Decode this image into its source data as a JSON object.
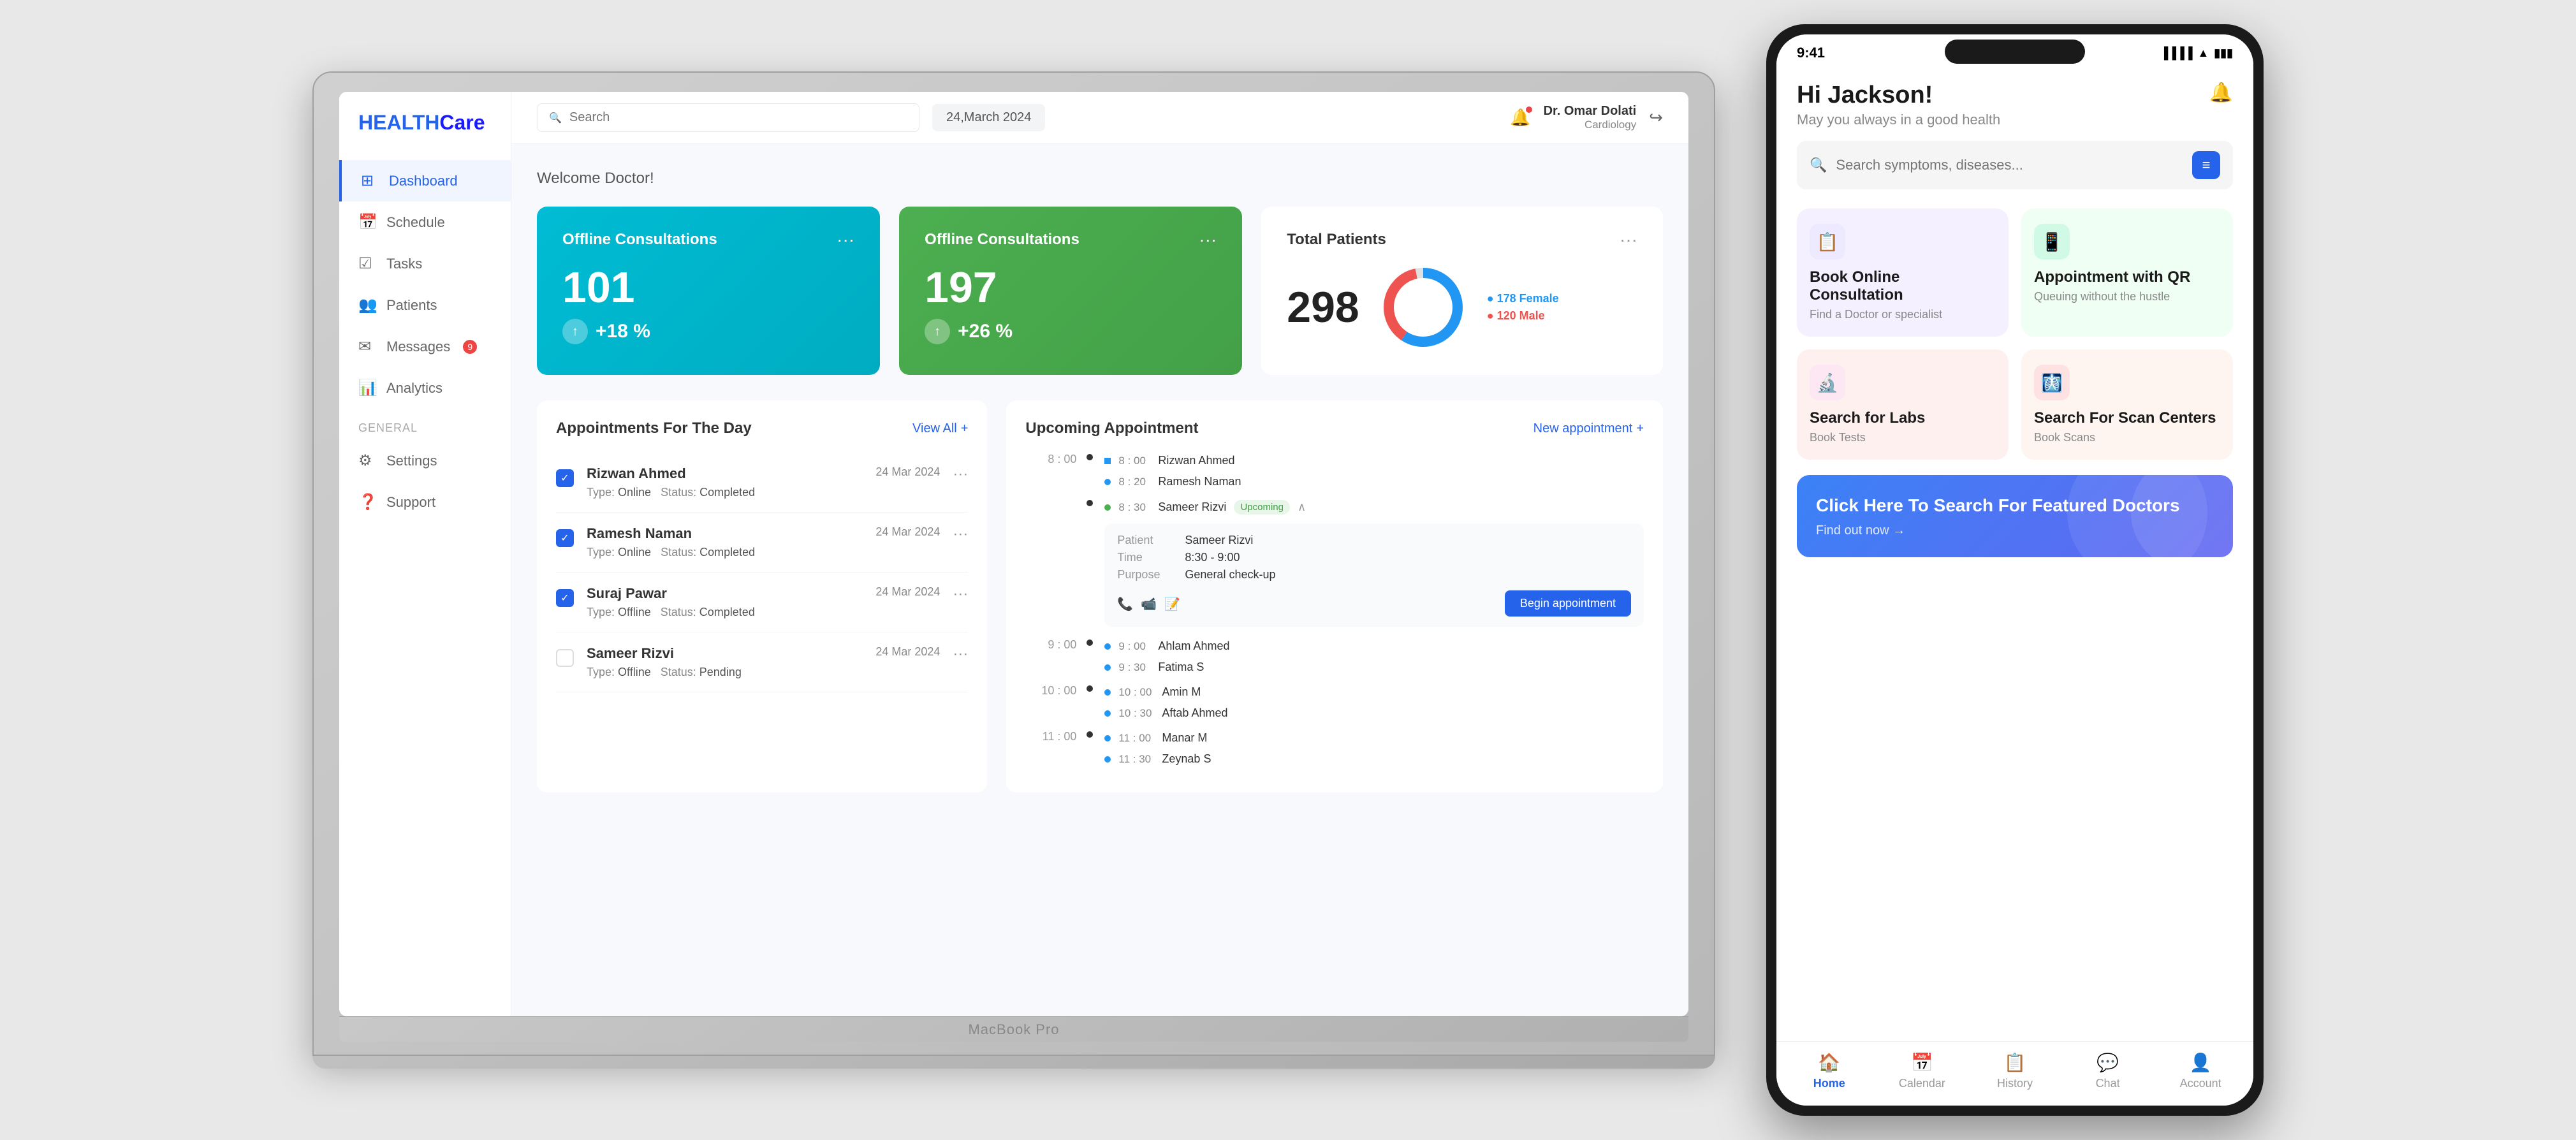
{
  "brand": {
    "name_plain": "HEALTH",
    "name_bold": "Care"
  },
  "sidebar": {
    "items": [
      {
        "id": "dashboard",
        "label": "Dashboard",
        "icon": "⊞",
        "active": true
      },
      {
        "id": "schedule",
        "label": "Schedule",
        "icon": "📅",
        "active": false
      },
      {
        "id": "tasks",
        "label": "Tasks",
        "icon": "☑",
        "active": false
      },
      {
        "id": "patients",
        "label": "Patients",
        "icon": "👥",
        "active": false
      },
      {
        "id": "messages",
        "label": "Messages",
        "icon": "✉",
        "active": false,
        "badge": "9"
      },
      {
        "id": "analytics",
        "label": "Analytics",
        "icon": "📊",
        "active": false
      }
    ],
    "general_label": "GENERAL",
    "general_items": [
      {
        "id": "settings",
        "label": "Settings",
        "icon": "⚙"
      },
      {
        "id": "support",
        "label": "Support",
        "icon": "❓"
      }
    ]
  },
  "topbar": {
    "search_placeholder": "Search",
    "date": "24,March 2024",
    "user_name": "Dr. Omar Dolati",
    "user_dept": "Cardiology"
  },
  "welcome": "Welcome Doctor!",
  "stats": {
    "card1": {
      "title": "Offline Consultations",
      "number": "101",
      "change": "+18 %"
    },
    "card2": {
      "title": "Offline Consultations",
      "number": "197",
      "change": "+26 %"
    },
    "patients": {
      "title": "Total Patients",
      "total": "298",
      "female_count": "178",
      "female_label": "178 Female",
      "male_count": "120",
      "male_label": "120 Male"
    }
  },
  "appointments": {
    "title": "Appointments For The Day",
    "view_all": "View All",
    "items": [
      {
        "name": "Rizwan Ahmed",
        "date": "24 Mar 2024",
        "type": "Online",
        "status": "Completed",
        "checked": true
      },
      {
        "name": "Ramesh Naman",
        "date": "24 Mar 2024",
        "type": "Online",
        "status": "Completed",
        "checked": true
      },
      {
        "name": "Suraj  Pawar",
        "date": "24 Mar 2024",
        "type": "Offline",
        "status": "Completed",
        "checked": true
      },
      {
        "name": "Sameer Rizvi",
        "date": "24 Mar 2024",
        "type": "Offline",
        "status": "Pending",
        "checked": false
      }
    ]
  },
  "upcoming": {
    "title": "Upcoming Appointment",
    "new_btn": "New appointment",
    "timeline": [
      {
        "time": "8 : 00",
        "events": [
          {
            "name": "Rizwan Ahmed",
            "time": "8 : 00",
            "color": "blue"
          },
          {
            "name": "Ramesh Naman",
            "time": "8 : 20",
            "color": "blue"
          }
        ]
      },
      {
        "time": "",
        "events": [
          {
            "name": "Sameer Rizvi",
            "time": "8 : 30",
            "color": "green",
            "badge": "Upcoming",
            "expanded": true
          }
        ]
      },
      {
        "time": "9 : 00",
        "events": [
          {
            "name": "Ahlam Ahmed",
            "time": "9 : 00",
            "color": "blue"
          },
          {
            "name": "Fatima S",
            "time": "9 : 30",
            "color": "blue"
          }
        ]
      },
      {
        "time": "10 : 00",
        "events": [
          {
            "name": "Amin M",
            "time": "10 : 00",
            "color": "blue"
          },
          {
            "name": "Aftab Ahmed",
            "time": "10 : 30",
            "color": "blue"
          }
        ]
      },
      {
        "time": "11 : 00",
        "events": [
          {
            "name": "Manar M",
            "time": "11 : 00",
            "color": "blue"
          },
          {
            "name": "Zeynab S",
            "time": "11 : 30",
            "color": "blue"
          }
        ]
      }
    ],
    "detail": {
      "patient": "Sameer Rizvi",
      "time": "8:30 - 9:00",
      "purpose": "General check-up",
      "begin_btn": "Begin appointment"
    }
  },
  "phone": {
    "status_time": "9:41",
    "greeting": "Hi Jackson!",
    "greeting_sub": "May you always in a good health",
    "search_placeholder": "Search symptoms, diseases...",
    "services": [
      {
        "name": "Book Online Consultation",
        "sub": "Find a Doctor or specialist",
        "color": "light-purple",
        "icon": "📋"
      },
      {
        "name": "Appointment with QR",
        "sub": "Queuing without the hustle",
        "color": "light-green",
        "icon": "📱"
      },
      {
        "name": "Search for Labs",
        "sub": "Book Tests",
        "color": "light-pink",
        "icon": "🔬"
      },
      {
        "name": "Search For Scan Centers",
        "sub": "Book Scans",
        "color": "light-peach",
        "icon": "🩻"
      }
    ],
    "featured": {
      "title": "Click Here To Search For Featured Doctors",
      "link": "Find out now →"
    },
    "nav": [
      {
        "id": "home",
        "label": "Home",
        "icon": "🏠",
        "active": true
      },
      {
        "id": "calendar",
        "label": "Calendar",
        "icon": "📅",
        "active": false
      },
      {
        "id": "history",
        "label": "History",
        "icon": "📋",
        "active": false
      },
      {
        "id": "chat",
        "label": "Chat",
        "icon": "💬",
        "active": false
      },
      {
        "id": "account",
        "label": "Account",
        "icon": "👤",
        "active": false
      }
    ]
  },
  "laptop_brand": "MacBook Pro"
}
